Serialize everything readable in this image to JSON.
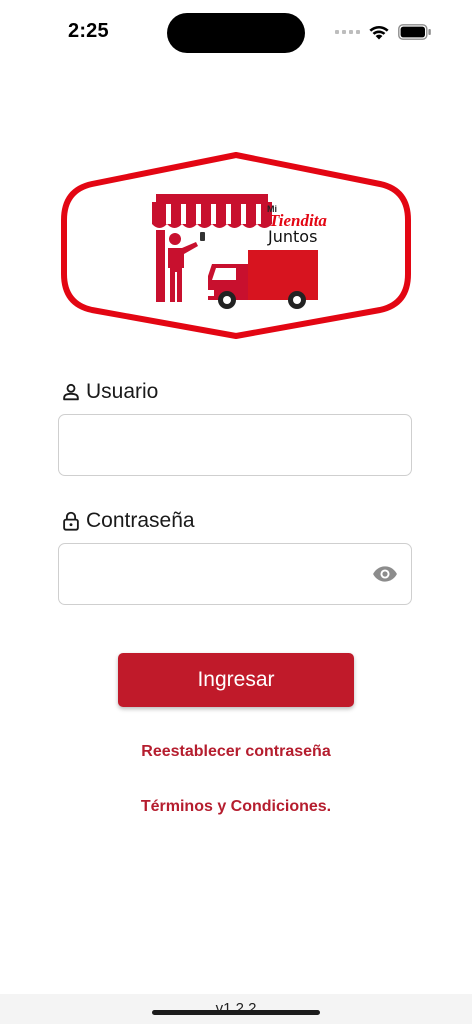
{
  "status_bar": {
    "time": "2:25",
    "signal_icon": "cellular-signal-icon",
    "wifi_icon": "wifi-icon",
    "battery_icon": "battery-icon"
  },
  "logo": {
    "text_mi": "Mi",
    "text_tiendita": "Tiendita",
    "text_juntos": "Juntos",
    "brand_color": "#e30613"
  },
  "username": {
    "label": "Usuario",
    "icon": "user-icon",
    "value": "",
    "placeholder": ""
  },
  "password": {
    "label": "Contraseña",
    "icon": "lock-icon",
    "value": "",
    "placeholder": "",
    "toggle_icon": "eye-icon"
  },
  "login_button": {
    "label": "Ingresar",
    "color": "#c01a2a"
  },
  "links": {
    "reset_password": "Reestablecer contraseña",
    "terms": "Términos y Condiciones.",
    "color": "#b51d2e"
  },
  "footer": {
    "version": "v1.2.2"
  }
}
